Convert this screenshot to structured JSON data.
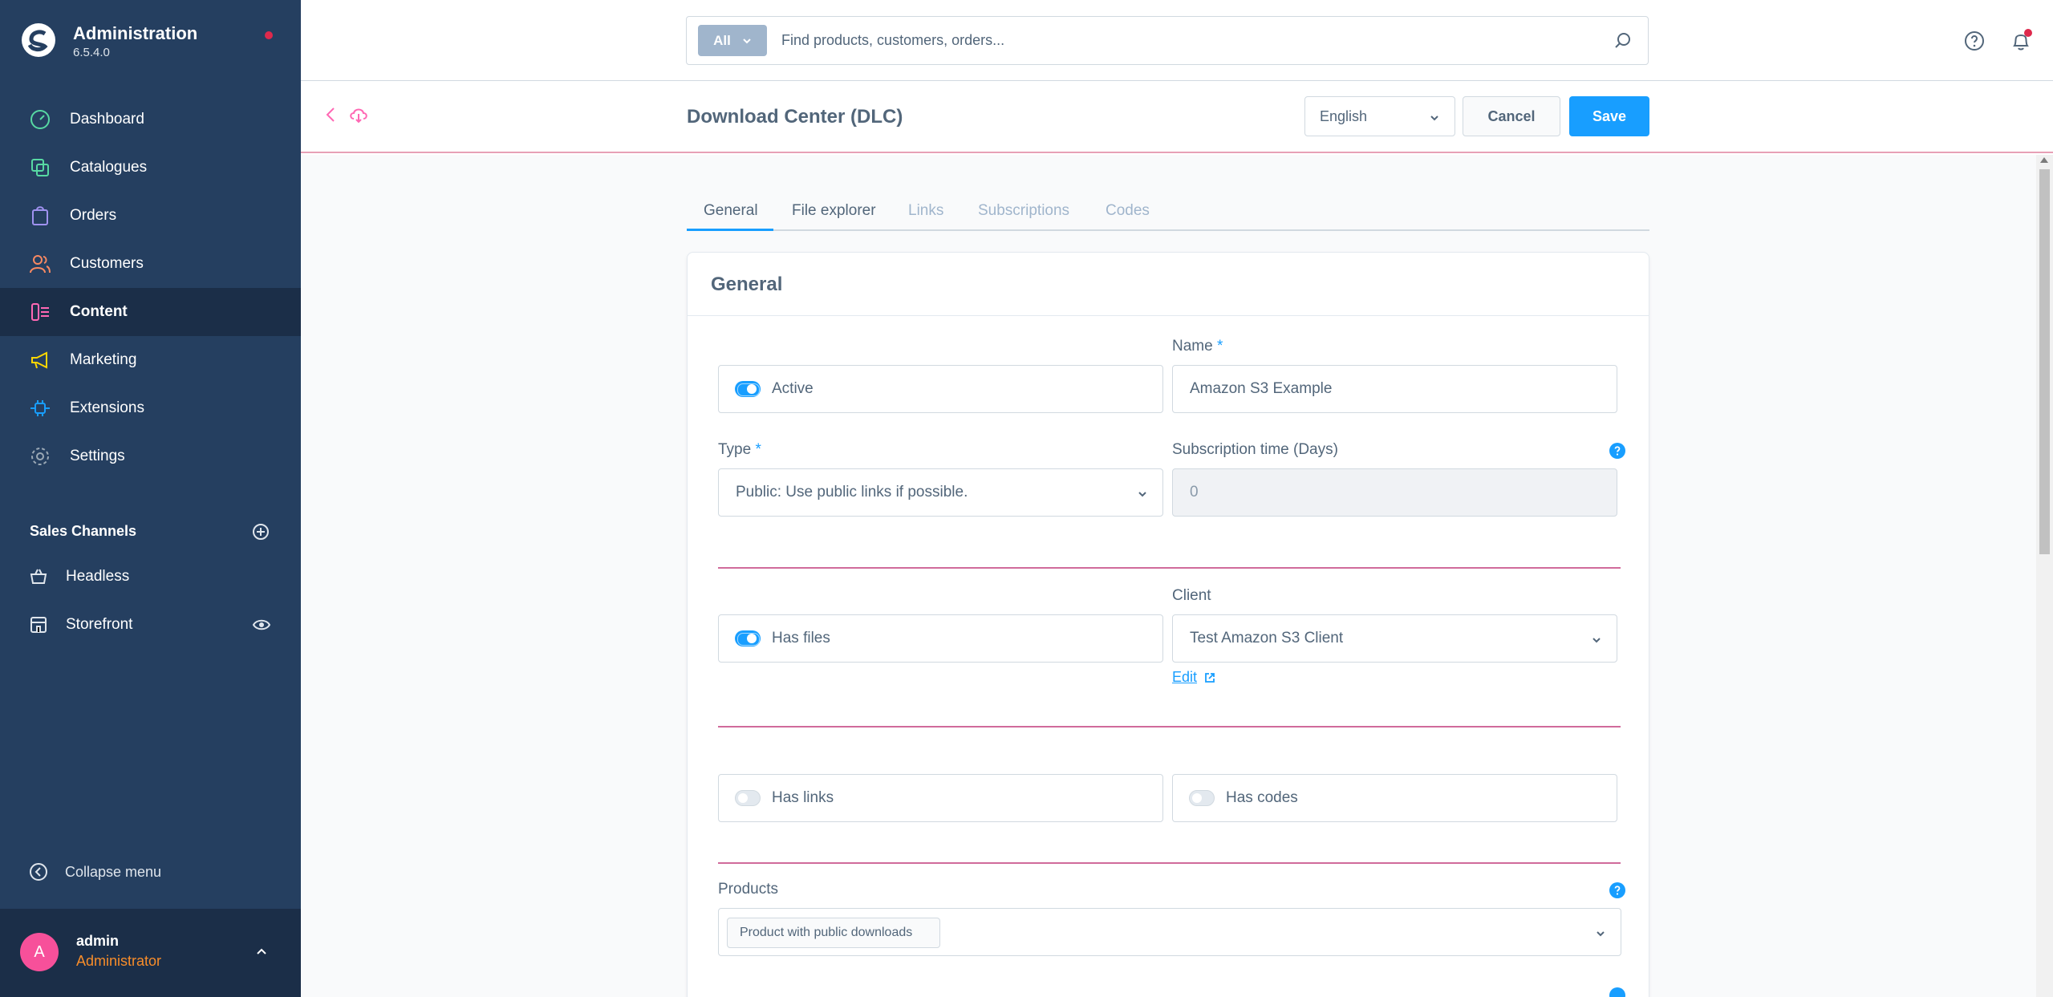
{
  "app": {
    "title": "Administration",
    "version": "6.5.4.0"
  },
  "sidebar": {
    "items": [
      {
        "label": "Dashboard",
        "icon": "dashboard-icon",
        "color": "#57d9a3"
      },
      {
        "label": "Catalogues",
        "icon": "catalogues-icon",
        "color": "#57d9a3"
      },
      {
        "label": "Orders",
        "icon": "orders-icon",
        "color": "#a092f0"
      },
      {
        "label": "Customers",
        "icon": "customers-icon",
        "color": "#f88962"
      },
      {
        "label": "Content",
        "icon": "content-icon",
        "color": "#ff68b4",
        "active": true
      },
      {
        "label": "Marketing",
        "icon": "marketing-icon",
        "color": "#ffd700"
      },
      {
        "label": "Extensions",
        "icon": "extensions-icon",
        "color": "#189eff"
      },
      {
        "label": "Settings",
        "icon": "settings-icon",
        "color": "#9aa8b5"
      }
    ],
    "sales_channels_title": "Sales Channels",
    "sales_channels": [
      {
        "label": "Headless",
        "icon": "basket-icon"
      },
      {
        "label": "Storefront",
        "icon": "storefront-icon"
      }
    ],
    "collapse_label": "Collapse menu",
    "user": {
      "initial": "A",
      "name": "admin",
      "role": "Administrator"
    }
  },
  "topbar": {
    "search_type": "All",
    "search_placeholder": "Find products, customers, orders..."
  },
  "smartbar": {
    "title": "Download Center (DLC)",
    "language": "English",
    "cancel_label": "Cancel",
    "save_label": "Save"
  },
  "tabs": [
    {
      "label": "General",
      "active": true,
      "disabled": false
    },
    {
      "label": "File explorer",
      "active": false,
      "disabled": false
    },
    {
      "label": "Links",
      "active": false,
      "disabled": true
    },
    {
      "label": "Subscriptions",
      "active": false,
      "disabled": true
    },
    {
      "label": "Codes",
      "active": false,
      "disabled": true
    }
  ],
  "card": {
    "title": "General",
    "active_label": "Active",
    "active_on": true,
    "name_label": "Name",
    "name_required": "*",
    "name_value": "Amazon S3 Example",
    "type_label": "Type",
    "type_required": "*",
    "type_value": "Public: Use public links if possible.",
    "subscription_label": "Subscription time (Days)",
    "subscription_value": "0",
    "has_files_label": "Has files",
    "has_files_on": true,
    "client_label": "Client",
    "client_value": "Test Amazon S3 Client",
    "edit_link": "Edit",
    "has_links_label": "Has links",
    "has_links_on": false,
    "has_codes_label": "Has codes",
    "has_codes_on": false,
    "products_label": "Products",
    "products_chip": "Product with public downloads"
  },
  "colors": {
    "sidebar_bg": "#253f60",
    "accent": "#189eff",
    "separator": "#c0397a"
  }
}
